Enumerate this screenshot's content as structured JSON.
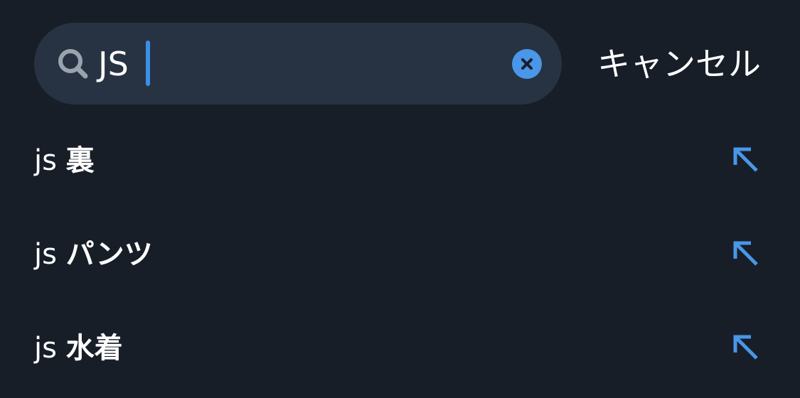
{
  "search": {
    "query": "JS",
    "cancel_label": "キャンセル"
  },
  "suggestions": [
    {
      "prefix": "js",
      "rest": "裏"
    },
    {
      "prefix": "js",
      "rest": "パンツ"
    },
    {
      "prefix": "js",
      "rest": "水着"
    }
  ],
  "icons": {
    "search": "search-icon",
    "clear": "clear-icon",
    "fill": "arrow-up-left-icon"
  },
  "colors": {
    "background": "#171e28",
    "field": "#273342",
    "accent": "#4a96e8",
    "text": "#ffffff",
    "icon_muted": "#9aa3ad"
  }
}
